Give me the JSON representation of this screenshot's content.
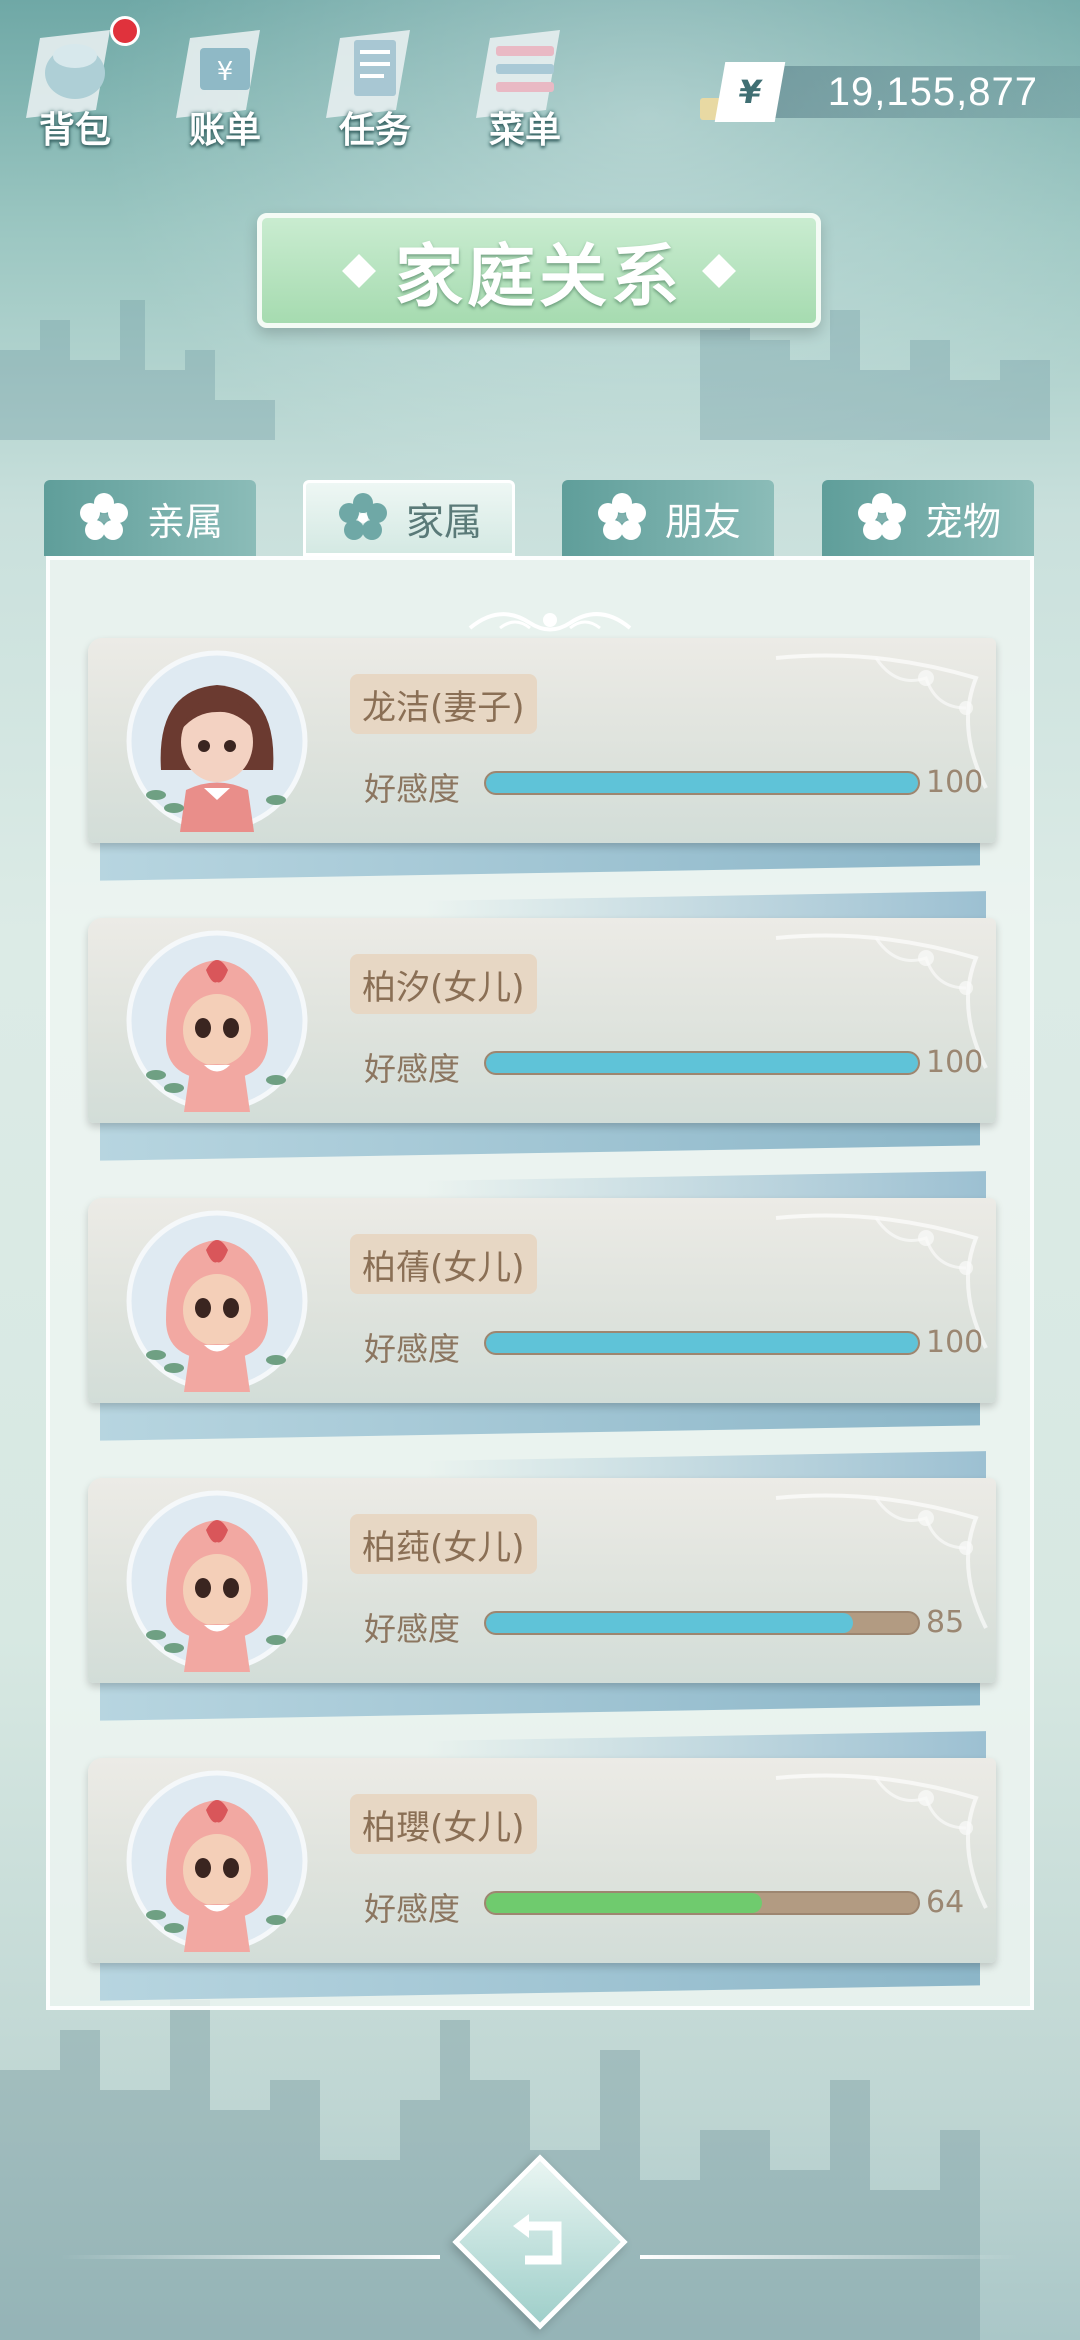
{
  "top_bar": {
    "buttons": [
      {
        "label": "背包",
        "icon": "backpack-icon",
        "badge": true
      },
      {
        "label": "账单",
        "icon": "bill-icon",
        "badge": false
      },
      {
        "label": "任务",
        "icon": "task-icon",
        "badge": false
      },
      {
        "label": "菜单",
        "icon": "menu-icon",
        "badge": false
      }
    ],
    "currency_symbol": "¥",
    "money": "19,155,877"
  },
  "title": "家庭关系",
  "tabs": [
    {
      "label": "亲属",
      "active": false
    },
    {
      "label": "家属",
      "active": true
    },
    {
      "label": "朋友",
      "active": false
    },
    {
      "label": "宠物",
      "active": false
    }
  ],
  "members": [
    {
      "name": "龙洁(妻子)",
      "affinity_label": "好感度",
      "affinity": 100,
      "bar_color": "#5fc3d8",
      "avatar": "woman-avatar-icon"
    },
    {
      "name": "柏汐(女儿)",
      "affinity_label": "好感度",
      "affinity": 100,
      "bar_color": "#5fc3d8",
      "avatar": "baby-avatar-icon"
    },
    {
      "name": "柏蒨(女儿)",
      "affinity_label": "好感度",
      "affinity": 100,
      "bar_color": "#5fc3d8",
      "avatar": "baby-avatar-icon"
    },
    {
      "name": "柏莼(女儿)",
      "affinity_label": "好感度",
      "affinity": 85,
      "bar_color": "#5fc3d8",
      "avatar": "baby-avatar-icon"
    },
    {
      "name": "柏瓔(女儿)",
      "affinity_label": "好感度",
      "affinity": 64,
      "bar_color": "#6fcb6e",
      "avatar": "baby-avatar-icon"
    }
  ],
  "back_icon": "back-arrow-icon"
}
